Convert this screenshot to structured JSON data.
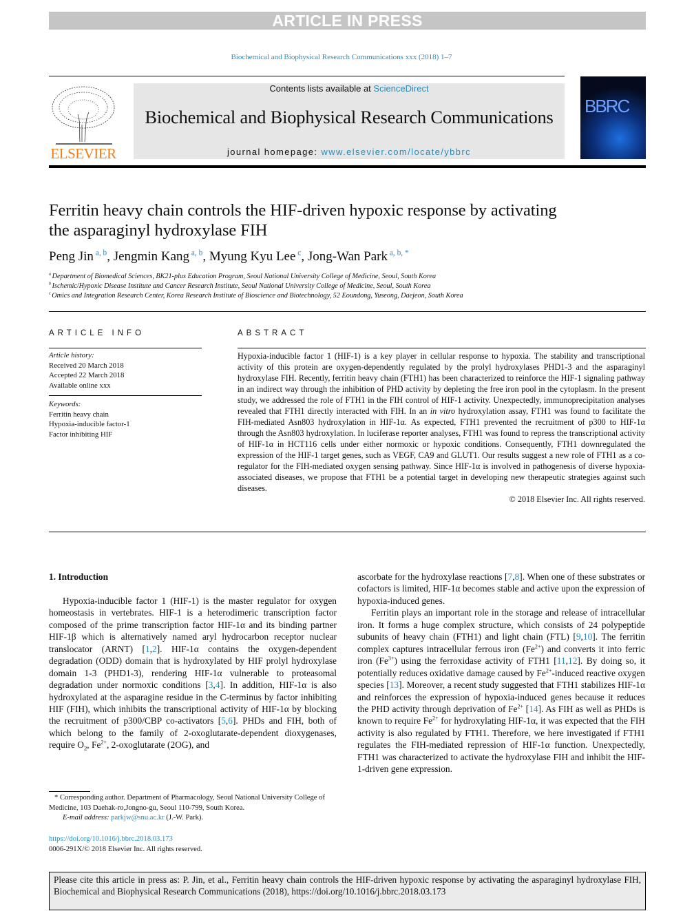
{
  "banner": "ARTICLE IN PRESS",
  "journal_ref": "Biochemical and Biophysical Research Communications xxx (2018) 1–7",
  "header": {
    "publisher": "ELSEVIER",
    "contents_prefix": "Contents lists available at ",
    "contents_link": "ScienceDirect",
    "journal_title": "Biochemical and Biophysical Research Communications",
    "homepage_prefix": "journal homepage: ",
    "homepage_link": "www.elsevier.com/locate/ybbrc",
    "cover_text": "BBRC",
    "link_color": "#2a8bb8",
    "publisher_color": "#f07d1a"
  },
  "title": "Ferritin heavy chain controls the HIF-driven hypoxic response by activating the asparaginyl hydroxylase FIH",
  "authors": [
    {
      "name": "Peng Jin",
      "sup": "a, b"
    },
    {
      "name": "Jengmin Kang",
      "sup": "a, b"
    },
    {
      "name": "Myung Kyu Lee",
      "sup": "c"
    },
    {
      "name": "Jong-Wan Park",
      "sup": "a, b, *"
    }
  ],
  "affiliations": [
    {
      "mark": "a",
      "text": "Department of Biomedical Sciences, BK21-plus Education Program, Seoul National University College of Medicine, Seoul, South Korea"
    },
    {
      "mark": "b",
      "text": "Ischemic/Hypoxic Disease Institute and Cancer Research Institute, Seoul National University College of Medicine, Seoul, South Korea"
    },
    {
      "mark": "c",
      "text": "Omics and Integration Research Center, Korea Research Institute of Bioscience and Biotechnology, 52 Eoundong, Yuseong, Daejeon, South Korea"
    }
  ],
  "article_info": {
    "heading": "ARTICLE INFO",
    "history_label": "Article history:",
    "history": [
      "Received 20 March 2018",
      "Accepted 22 March 2018",
      "Available online xxx"
    ],
    "keywords_label": "Keywords:",
    "keywords": [
      "Ferritin heavy chain",
      "Hypoxia-inducible factor-1",
      "Factor inhibiting HIF"
    ]
  },
  "abstract": {
    "heading": "ABSTRACT",
    "segments": [
      "Hypoxia-inducible factor 1 (HIF-1) is a key player in cellular response to hypoxia. The stability and transcriptional activity of this protein are oxygen-dependently regulated by the prolyl hydroxylases PHD1-3 and the asparaginyl hydroxylase FIH. Recently, ferritin heavy chain (FTH1) has been characterized to reinforce the HIF-1 signaling pathway in an indirect way through the inhibition of PHD activity by depleting the free iron pool in the cytoplasm. In the present study, we addressed the role of FTH1 in the FIH control of HIF-1 activity. Unexpectedly, immunoprecipitation analyses revealed that FTH1 directly interacted with FIH. In an ",
      {
        "t": "in vitro",
        "c": "i"
      },
      " hydroxylation assay, FTH1 was found to facilitate the FIH-mediated Asn803 hydroxylation in HIF-1α. As expected, FTH1 prevented the recruitment of p300 to HIF-1α through the Asn803 hydroxylation. In luciferase reporter analyses, FTH1 was found to repress the transcriptional activity of HIF-1α in HCT116 cells under either normoxic or hypoxic conditions. Consequently, FTH1 downregulated the expression of the HIF-1 target genes, such as VEGF, CA9 and GLUT1. Our results suggest a new role of FTH1 as a co-regulator for the FIH-mediated oxygen sensing pathway. Since HIF-1α is involved in pathogenesis of diverse hypoxia-associated diseases, we propose that FTH1 be a potential target in developing new therapeutic strategies against such diseases."
    ],
    "copyright": "© 2018 Elsevier Inc. All rights reserved."
  },
  "intro": {
    "heading": "1.  Introduction",
    "col1": [
      [
        "Hypoxia-inducible factor 1 (HIF-1) is the master regulator for oxygen homeostasis in vertebrates. HIF-1 is a heterodimeric transcription factor composed of the prime transcription factor HIF-1α and its binding partner HIF-1β which is alternatively named aryl hydrocarbon receptor nuclear translocator (ARNT) [",
        {
          "t": "1",
          "c": "lk"
        },
        ",",
        {
          "t": "2",
          "c": "lk"
        },
        "]. HIF-1α contains the oxygen-dependent degradation (ODD) domain that is hydroxylated by HIF prolyl hydroxylase domain 1-3 (PHD1-3), rendering HIF-1α vulnerable to proteasomal degradation under normoxic conditions [",
        {
          "t": "3",
          "c": "lk"
        },
        ",",
        {
          "t": "4",
          "c": "lk"
        },
        "]. In addition, HIF-1α is also hydroxylated at the asparagine residue in the C-terminus by factor inhibiting HIF (FIH), which inhibits the transcriptional activity of HIF-1α by blocking the recruitment of p300/CBP co-activators [",
        {
          "t": "5",
          "c": "lk"
        },
        ",",
        {
          "t": "6",
          "c": "lk"
        },
        "]. PHDs and FIH, both of which belong to the family of 2-oxoglutarate-dependent dioxygenases, require O",
        {
          "t": "2",
          "c": "sub"
        },
        ", Fe",
        {
          "t": "2+",
          "c": "sup"
        },
        ", 2-oxoglutarate (2OG), and"
      ]
    ],
    "col2": [
      [
        "ascorbate for the hydroxylase reactions [",
        {
          "t": "7",
          "c": "lk"
        },
        ",",
        {
          "t": "8",
          "c": "lk"
        },
        "]. When one of these substrates or cofactors is limited, HIF-1α becomes stable and active upon the expression of hypoxia-induced genes."
      ],
      [
        "Ferritin plays an important role in the storage and release of intracellular iron. It forms a huge complex structure, which consists of 24 polypeptide subunits of heavy chain (FTH1) and light chain (FTL) [",
        {
          "t": "9",
          "c": "lk"
        },
        ",",
        {
          "t": "10",
          "c": "lk"
        },
        "]. The ferritin complex captures intracellular ferrous iron (Fe",
        {
          "t": "2+",
          "c": "sup"
        },
        ") and converts it into ferric iron (Fe",
        {
          "t": "3+",
          "c": "sup"
        },
        ") using the ferroxidase activity of FTH1 [",
        {
          "t": "11",
          "c": "lk"
        },
        ",",
        {
          "t": "12",
          "c": "lk"
        },
        "]. By doing so, it potentially reduces oxidative damage caused by Fe",
        {
          "t": "2+",
          "c": "sup"
        },
        "-induced reactive oxygen species [",
        {
          "t": "13",
          "c": "lk"
        },
        "]. Moreover, a recent study suggested that FTH1 stabilizes HIF-1α and reinforces the expression of hypoxia-induced genes because it reduces the PHD activity through deprivation of Fe",
        {
          "t": "2+",
          "c": "sup"
        },
        " [",
        {
          "t": "14",
          "c": "lk"
        },
        "]. As FIH as well as PHDs is known to require Fe",
        {
          "t": "2+",
          "c": "sup"
        },
        " for hydroxylating HIF-1α, it was expected that the FIH activity is also regulated by FTH1. Therefore, we here investigated if FTH1 regulates the FIH-mediated repression of HIF-1α function. Unexpectedly, FTH1 was characterized to activate the hydroxylase FIH and inhibit the HIF-1-driven gene expression."
      ]
    ]
  },
  "footnote": {
    "corresponding": "* Corresponding author. Department of Pharmacology, Seoul National University College of Medicine, 103 Daehak-ro,Jongno-gu, Seoul 110-799, South Korea.",
    "email_label": "E-mail address: ",
    "email": "parkjw@snu.ac.kr",
    "email_suffix": " (J.-W. Park).",
    "doi": "https://doi.org/10.1016/j.bbrc.2018.03.173",
    "issn": "0006-291X/© 2018 Elsevier Inc. All rights reserved."
  },
  "citation_box": "Please cite this article in press as: P. Jin, et al., Ferritin heavy chain controls the HIF-driven hypoxic response by activating the asparaginyl hydroxylase FIH, Biochemical and Biophysical Research Communications (2018), https://doi.org/10.1016/j.bbrc.2018.03.173"
}
